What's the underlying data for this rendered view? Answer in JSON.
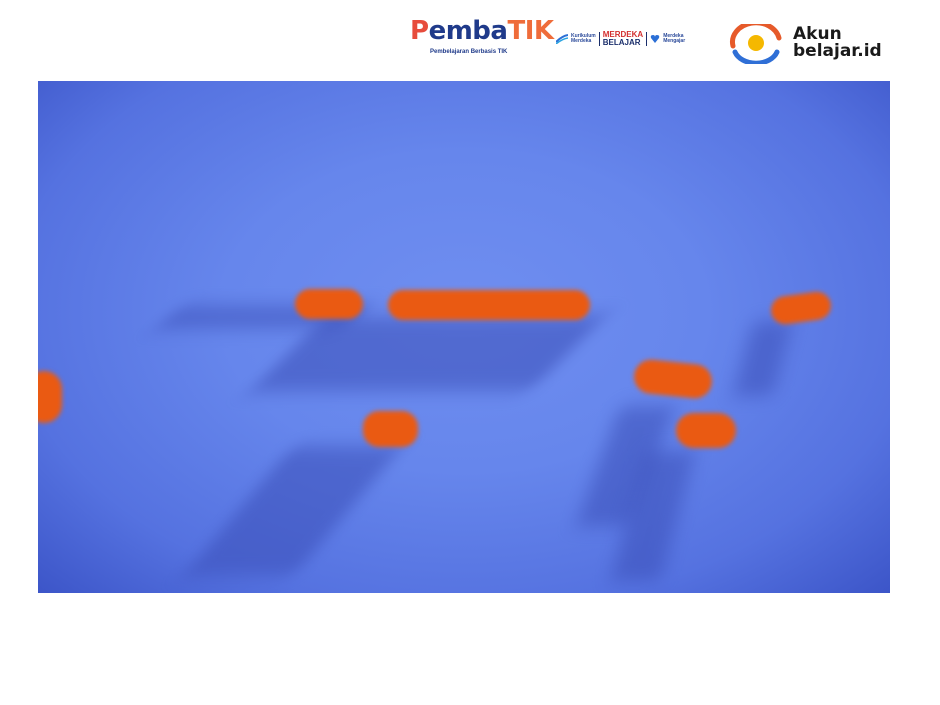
{
  "header": {
    "pembatik": {
      "p": "P",
      "mid": "emba",
      "tik": "TIK",
      "tagline": "Pembelajaran Berbasis TIK"
    },
    "kurikulum": {
      "line1": "Kurikulum",
      "line2": "Merdeka",
      "merdeka_top": "MERDEKA",
      "merdeka_bottom": "BELAJAR",
      "mengajar1": "Merdeka",
      "mengajar2": "Mengajar"
    },
    "akun": {
      "line1": "Akun",
      "line2": "belajar.id"
    }
  },
  "colors": {
    "background": "#6686ec",
    "shape": "#ea5a12",
    "shadow": "#3b4fb8"
  },
  "video": {
    "content": "abstract-orange-shapes-on-blue"
  }
}
